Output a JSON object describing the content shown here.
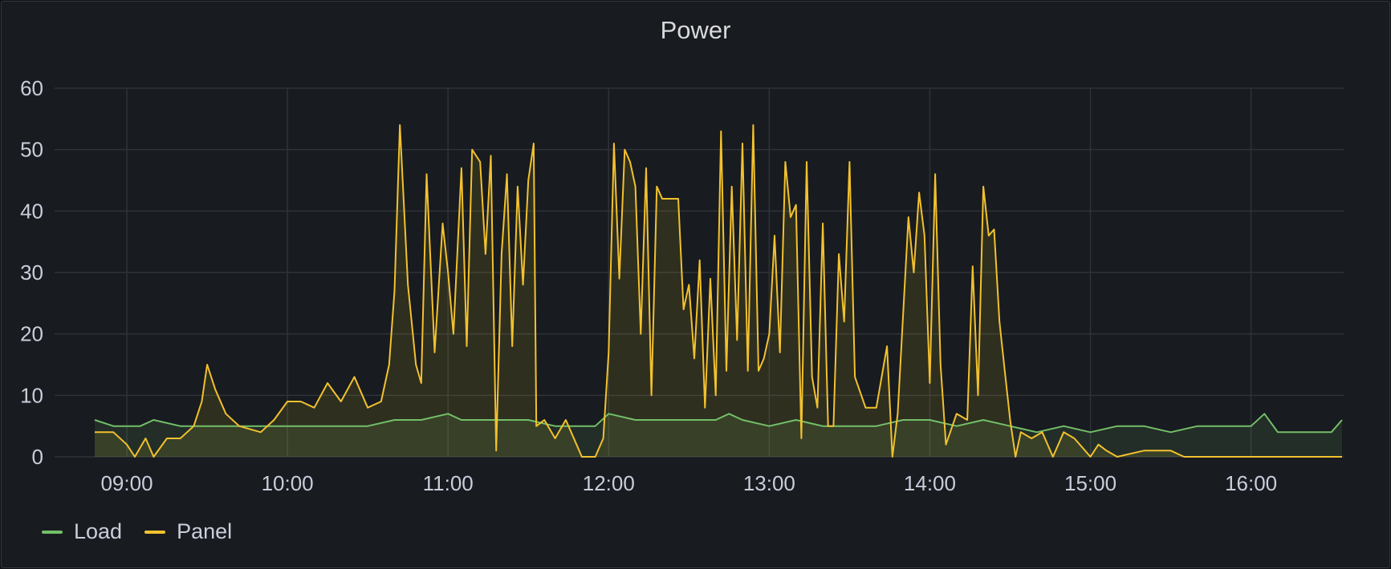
{
  "panel": {
    "title": "Power"
  },
  "colors": {
    "load": "#73bf69",
    "panel": "#fade2a",
    "panel_line": "#f2c12e",
    "grid": "#2f3238",
    "text": "#ccccdc"
  },
  "legend": [
    {
      "name": "Load",
      "color": "#73bf69"
    },
    {
      "name": "Panel",
      "color": "#f2c12e"
    }
  ],
  "chart_data": {
    "type": "line",
    "title": "Power",
    "xlabel": "",
    "ylabel": "",
    "ylim": [
      0,
      60
    ],
    "xlim_minutes": [
      0,
      0
    ],
    "yticks": [
      "0",
      "10",
      "20",
      "30",
      "40",
      "50",
      "60"
    ],
    "xticks": [
      "09:00",
      "10:00",
      "11:00",
      "12:00",
      "13:00",
      "14:00",
      "15:00",
      "16:00"
    ],
    "grid": true,
    "legend_position": "bottom-left",
    "x_start": "08:48",
    "x_end": "16:34",
    "series": [
      {
        "name": "Load",
        "color": "#73bf69",
        "points": [
          [
            "08:48",
            6
          ],
          [
            "08:55",
            5
          ],
          [
            "09:05",
            5
          ],
          [
            "09:10",
            6
          ],
          [
            "09:20",
            5
          ],
          [
            "09:40",
            5
          ],
          [
            "09:50",
            5
          ],
          [
            "10:00",
            5
          ],
          [
            "10:10",
            5
          ],
          [
            "10:20",
            5
          ],
          [
            "10:30",
            5
          ],
          [
            "10:40",
            6
          ],
          [
            "10:50",
            6
          ],
          [
            "11:00",
            7
          ],
          [
            "11:05",
            6
          ],
          [
            "11:15",
            6
          ],
          [
            "11:20",
            6
          ],
          [
            "11:30",
            6
          ],
          [
            "11:40",
            5
          ],
          [
            "11:50",
            5
          ],
          [
            "11:55",
            5
          ],
          [
            "12:00",
            7
          ],
          [
            "12:10",
            6
          ],
          [
            "12:20",
            6
          ],
          [
            "12:30",
            6
          ],
          [
            "12:40",
            6
          ],
          [
            "12:45",
            7
          ],
          [
            "12:50",
            6
          ],
          [
            "13:00",
            5
          ],
          [
            "13:10",
            6
          ],
          [
            "13:20",
            5
          ],
          [
            "13:30",
            5
          ],
          [
            "13:40",
            5
          ],
          [
            "13:50",
            6
          ],
          [
            "14:00",
            6
          ],
          [
            "14:10",
            5
          ],
          [
            "14:20",
            6
          ],
          [
            "14:30",
            5
          ],
          [
            "14:40",
            4
          ],
          [
            "14:50",
            5
          ],
          [
            "15:00",
            4
          ],
          [
            "15:10",
            5
          ],
          [
            "15:20",
            5
          ],
          [
            "15:30",
            4
          ],
          [
            "15:40",
            5
          ],
          [
            "15:50",
            5
          ],
          [
            "16:00",
            5
          ],
          [
            "16:05",
            7
          ],
          [
            "16:10",
            4
          ],
          [
            "16:20",
            4
          ],
          [
            "16:30",
            4
          ],
          [
            "16:34",
            6
          ]
        ]
      },
      {
        "name": "Panel",
        "color": "#f2c12e",
        "points": [
          [
            "08:48",
            4
          ],
          [
            "08:55",
            4
          ],
          [
            "09:00",
            2
          ],
          [
            "09:03",
            0
          ],
          [
            "09:07",
            3
          ],
          [
            "09:10",
            0
          ],
          [
            "09:15",
            3
          ],
          [
            "09:20",
            3
          ],
          [
            "09:25",
            5
          ],
          [
            "09:28",
            9
          ],
          [
            "09:30",
            15
          ],
          [
            "09:33",
            11
          ],
          [
            "09:37",
            7
          ],
          [
            "09:42",
            5
          ],
          [
            "09:50",
            4
          ],
          [
            "09:55",
            6
          ],
          [
            "10:00",
            9
          ],
          [
            "10:05",
            9
          ],
          [
            "10:10",
            8
          ],
          [
            "10:15",
            12
          ],
          [
            "10:20",
            9
          ],
          [
            "10:25",
            13
          ],
          [
            "10:30",
            8
          ],
          [
            "10:35",
            9
          ],
          [
            "10:38",
            15
          ],
          [
            "10:40",
            27
          ],
          [
            "10:42",
            54
          ],
          [
            "10:45",
            28
          ],
          [
            "10:48",
            15
          ],
          [
            "10:50",
            12
          ],
          [
            "10:52",
            46
          ],
          [
            "10:55",
            17
          ],
          [
            "10:58",
            38
          ],
          [
            "11:00",
            30
          ],
          [
            "11:02",
            20
          ],
          [
            "11:05",
            47
          ],
          [
            "11:07",
            18
          ],
          [
            "11:09",
            50
          ],
          [
            "11:12",
            48
          ],
          [
            "11:14",
            33
          ],
          [
            "11:16",
            49
          ],
          [
            "11:18",
            1
          ],
          [
            "11:20",
            33
          ],
          [
            "11:22",
            46
          ],
          [
            "11:24",
            18
          ],
          [
            "11:26",
            44
          ],
          [
            "11:28",
            28
          ],
          [
            "11:30",
            45
          ],
          [
            "11:32",
            51
          ],
          [
            "11:33",
            5
          ],
          [
            "11:36",
            6
          ],
          [
            "11:40",
            3
          ],
          [
            "11:44",
            6
          ],
          [
            "11:48",
            2
          ],
          [
            "11:50",
            0
          ],
          [
            "11:55",
            0
          ],
          [
            "11:58",
            3
          ],
          [
            "12:00",
            17
          ],
          [
            "12:02",
            51
          ],
          [
            "12:04",
            29
          ],
          [
            "12:06",
            50
          ],
          [
            "12:08",
            48
          ],
          [
            "12:10",
            44
          ],
          [
            "12:12",
            20
          ],
          [
            "12:14",
            47
          ],
          [
            "12:16",
            10
          ],
          [
            "12:18",
            44
          ],
          [
            "12:20",
            42
          ],
          [
            "12:22",
            42
          ],
          [
            "12:26",
            42
          ],
          [
            "12:28",
            24
          ],
          [
            "12:30",
            28
          ],
          [
            "12:32",
            16
          ],
          [
            "12:34",
            32
          ],
          [
            "12:36",
            8
          ],
          [
            "12:38",
            29
          ],
          [
            "12:40",
            10
          ],
          [
            "12:42",
            53
          ],
          [
            "12:44",
            14
          ],
          [
            "12:46",
            44
          ],
          [
            "12:48",
            19
          ],
          [
            "12:50",
            51
          ],
          [
            "12:52",
            14
          ],
          [
            "12:54",
            54
          ],
          [
            "12:56",
            14
          ],
          [
            "12:58",
            16
          ],
          [
            "13:00",
            20
          ],
          [
            "13:02",
            36
          ],
          [
            "13:04",
            17
          ],
          [
            "13:06",
            48
          ],
          [
            "13:08",
            39
          ],
          [
            "13:10",
            41
          ],
          [
            "13:12",
            3
          ],
          [
            "13:14",
            48
          ],
          [
            "13:16",
            13
          ],
          [
            "13:18",
            8
          ],
          [
            "13:20",
            38
          ],
          [
            "13:22",
            5
          ],
          [
            "13:24",
            5
          ],
          [
            "13:26",
            33
          ],
          [
            "13:28",
            22
          ],
          [
            "13:30",
            48
          ],
          [
            "13:32",
            13
          ],
          [
            "13:36",
            8
          ],
          [
            "13:40",
            8
          ],
          [
            "13:44",
            18
          ],
          [
            "13:46",
            0
          ],
          [
            "13:48",
            7
          ],
          [
            "13:52",
            39
          ],
          [
            "13:54",
            30
          ],
          [
            "13:56",
            43
          ],
          [
            "13:58",
            36
          ],
          [
            "14:00",
            12
          ],
          [
            "14:02",
            46
          ],
          [
            "14:04",
            15
          ],
          [
            "14:06",
            2
          ],
          [
            "14:10",
            7
          ],
          [
            "14:14",
            6
          ],
          [
            "14:16",
            31
          ],
          [
            "14:18",
            10
          ],
          [
            "14:20",
            44
          ],
          [
            "14:22",
            36
          ],
          [
            "14:24",
            37
          ],
          [
            "14:26",
            22
          ],
          [
            "14:28",
            14
          ],
          [
            "14:30",
            6
          ],
          [
            "14:32",
            0
          ],
          [
            "14:34",
            4
          ],
          [
            "14:38",
            3
          ],
          [
            "14:42",
            4
          ],
          [
            "14:46",
            0
          ],
          [
            "14:50",
            4
          ],
          [
            "14:54",
            3
          ],
          [
            "14:58",
            1
          ],
          [
            "15:00",
            0
          ],
          [
            "15:03",
            2
          ],
          [
            "15:06",
            1
          ],
          [
            "15:10",
            0
          ],
          [
            "15:20",
            1
          ],
          [
            "15:30",
            1
          ],
          [
            "15:35",
            0
          ],
          [
            "16:34",
            0
          ]
        ]
      }
    ]
  }
}
